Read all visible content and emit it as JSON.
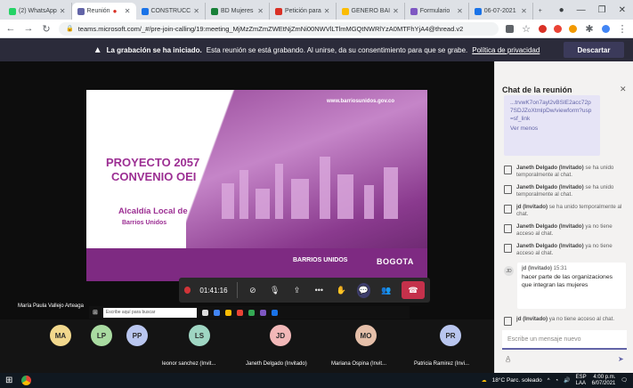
{
  "browser": {
    "tabs": [
      {
        "label": "(2) WhatsApp",
        "color": "#25d366"
      },
      {
        "label": "Reunión",
        "color": "#6264a7",
        "active": true
      },
      {
        "label": "CONSTRUCC",
        "color": "#1a73e8"
      },
      {
        "label": "BD Mujeres",
        "color": "#188038"
      },
      {
        "label": "Petición para",
        "color": "#d93025"
      },
      {
        "label": "GENERO BAI",
        "color": "#fbbc04"
      },
      {
        "label": "Formulario",
        "color": "#7e57c2"
      },
      {
        "label": "06-07-2021",
        "color": "#1a73e8"
      }
    ],
    "url": "teams.microsoft.com/_#/pre-join-calling/19:meeting_MjMzZmZmZWEtNjZmNi00NWVlLTlmMGQtNWRlYzA0MTFhYjA4@thread.v2"
  },
  "banner": {
    "bold_text": "La grabación se ha iniciado.",
    "text": "Esta reunión se está grabando. Al unirse, da su consentimiento para que se grabe.",
    "link": "Política de privacidad",
    "dismiss": "Descartar"
  },
  "slide": {
    "url": "www.barriosunidos.gov.co",
    "title_line1": "PROYECTO 2057",
    "title_line2": "CONVENIO OEI",
    "sub_line1": "Alcaldía Local de",
    "sub_line2": "Barrios Unidos",
    "brand_small": "BARRIOS UNIDOS",
    "brand_city": "BOGOTA"
  },
  "controls": {
    "timer": "01:41:16"
  },
  "presenter": "María Paula Vallejo Arteaga",
  "inner_taskbar": {
    "search_placeholder": "Escribe aquí para buscar"
  },
  "participants": [
    {
      "initials": "MA",
      "color": "#f2d88d"
    },
    {
      "initials": "LP",
      "color": "#a9dba1"
    },
    {
      "initials": "PP",
      "color": "#b9c6ef"
    },
    {
      "initials": "LS",
      "color": "#9fd6c3",
      "name": "leonor sanchez (Invit..."
    },
    {
      "initials": "JD",
      "color": "#f2b8b8",
      "name": "Janeth Delgado (Invitado)"
    },
    {
      "initials": "MO",
      "color": "#e5bfa9",
      "name": "Mariana Ospina (Invit..."
    },
    {
      "initials": "PR",
      "color": "#b9c6ef",
      "name": "Patricia Ramirez (Invi..."
    }
  ],
  "chat": {
    "title": "Chat de la reunión",
    "link_text": "...trvwK7on7ayl2vBSIE2acc72p7SDJZoXtmlpDw/viewform?usp=sf_link",
    "see_less": "Ver menos",
    "system_messages": [
      {
        "who": "Janeth Delgado (Invitado)",
        "text": "se ha unido temporalmente al chat."
      },
      {
        "who": "Janeth Delgado (Invitado)",
        "text": "se ha unido temporalmente al chat."
      },
      {
        "who": "jd (Invitado)",
        "text": "se ha unido temporalmente al chat."
      },
      {
        "who": "Janeth Delgado (Invitado)",
        "text": "ya no tiene acceso al chat."
      },
      {
        "who": "Janeth Delgado (Invitado)",
        "text": "ya no tiene acceso al chat."
      }
    ],
    "message": {
      "author": "jd (Invitado)",
      "time": "15:31",
      "initials": "JD",
      "text": "hacer parte de las organizaciones que integran las mujeres"
    },
    "last_system": {
      "who": "jd (Invitado)",
      "text": "ya no tiene acceso al chat."
    },
    "input_placeholder": "Escribe un mensaje nuevo"
  },
  "taskbar": {
    "weather": "18°C Parc. soleado",
    "lang1": "ESP",
    "lang2": "LAA",
    "time": "4:00 p.m.",
    "date": "6/07/2021"
  }
}
